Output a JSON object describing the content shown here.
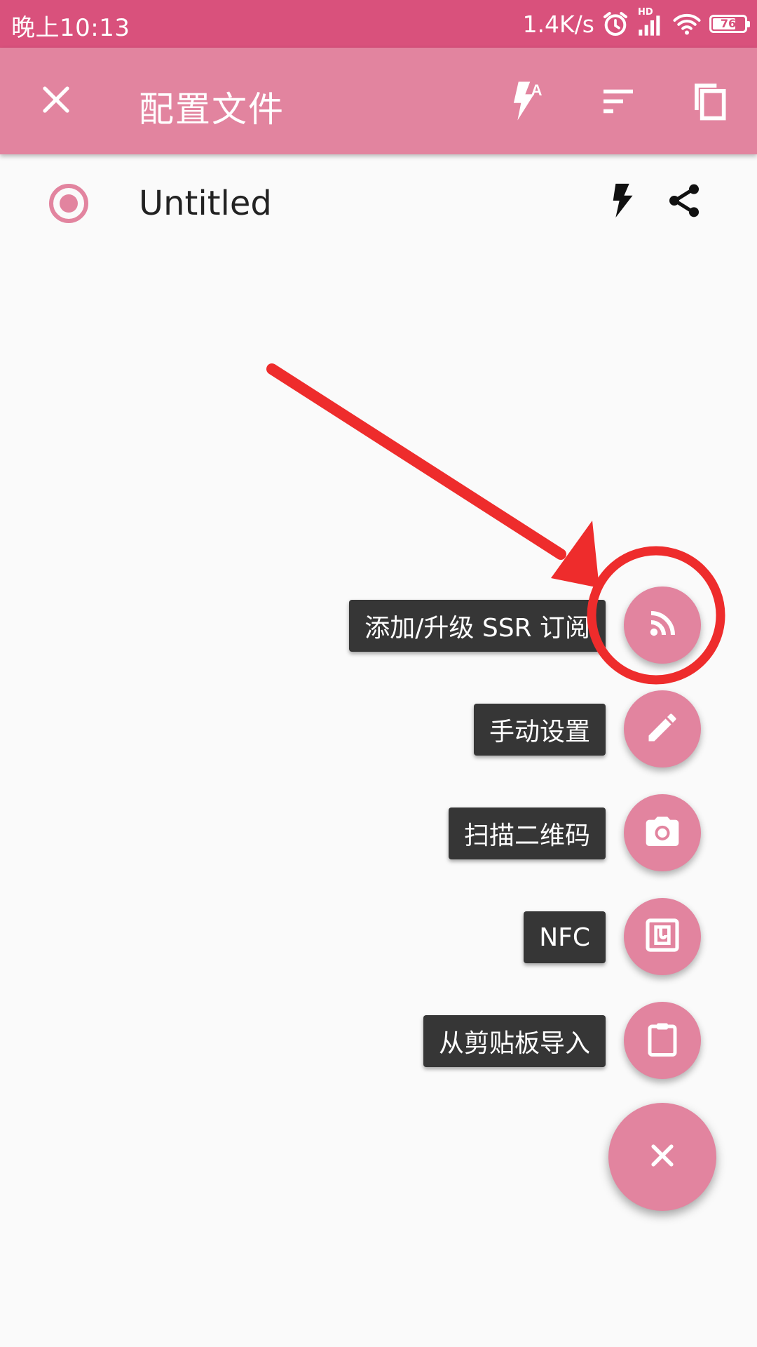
{
  "status_bar": {
    "time": "晚上10:13",
    "speed": "1.4K/s",
    "network_badge": "HD",
    "battery_level": "76",
    "icons": [
      "alarm-icon",
      "signal-icon",
      "wifi-icon",
      "battery-icon"
    ]
  },
  "app_bar": {
    "title": "配置文件",
    "actions": [
      "close-icon",
      "flash-auto-icon",
      "sort-icon",
      "copy-icon"
    ]
  },
  "profile": {
    "name": "Untitled",
    "selected": true,
    "actions": [
      "flash-icon",
      "share-icon"
    ]
  },
  "fab_menu": {
    "items": [
      {
        "label": "添加/升级 SSR 订阅",
        "icon": "rss-icon"
      },
      {
        "label": "手动设置",
        "icon": "edit-icon"
      },
      {
        "label": "扫描二维码",
        "icon": "camera-icon"
      },
      {
        "label": "NFC",
        "icon": "nfc-icon"
      },
      {
        "label": "从剪贴板导入",
        "icon": "clipboard-icon"
      }
    ],
    "main_icon": "close-icon"
  },
  "annotation": {
    "color": "#ee2c2c",
    "shapes": [
      "arrow",
      "circle"
    ]
  },
  "colors": {
    "status_bar": "#d9517c",
    "primary": "#e2849f",
    "tooltip": "#363636",
    "background": "#fafafa"
  }
}
